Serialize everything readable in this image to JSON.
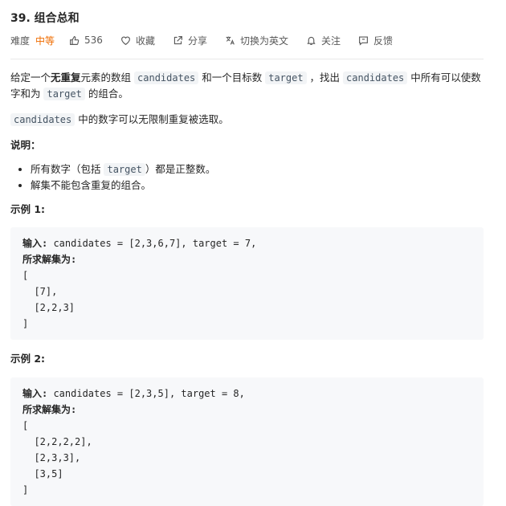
{
  "problem": {
    "title": "39. 组合总和"
  },
  "meta": {
    "difficulty_label": "难度",
    "difficulty": "中等",
    "likes": "536",
    "favorite": "收藏",
    "share": "分享",
    "switch_lang": "切换为英文",
    "follow": "关注",
    "feedback": "反馈",
    "colors": {
      "difficulty": "#ef6c00",
      "text": "#595959"
    },
    "icons": [
      "thumbs-up-icon",
      "heart-icon",
      "share-icon",
      "translate-icon",
      "bell-icon",
      "feedback-icon"
    ]
  },
  "description": {
    "p1_a": "给定一个",
    "p1_bold": "无重复",
    "p1_b": "元素的数组 ",
    "code_candidates": "candidates",
    "p1_c": " 和一个目标数 ",
    "code_target": "target",
    "p1_d": " ，找出 ",
    "p1_e": " 中所有可以使数字和为 ",
    "p1_f": " 的组合。",
    "p2_b": " 中的数字可以无限制重复被选取。",
    "note_title": "说明：",
    "note1_a": "所有数字（包括 ",
    "note1_b": "）都是正整数。",
    "note2": "解集不能包含重复的组合。"
  },
  "examples": [
    {
      "title": "示例 1:",
      "input_label": "输入:",
      "input": " candidates = [2,3,6,7], target = 7,",
      "output_label": "所求解集为:",
      "lines": [
        "[",
        "  [7],",
        "  [2,2,3]",
        "]"
      ]
    },
    {
      "title": "示例 2:",
      "input_label": "输入:",
      "input": " candidates = [2,3,5], target = 8,",
      "output_label": "所求解集为:",
      "lines": [
        "[",
        "  [2,2,2,2],",
        "  [2,3,3],",
        "  [3,5]",
        "]"
      ]
    }
  ]
}
